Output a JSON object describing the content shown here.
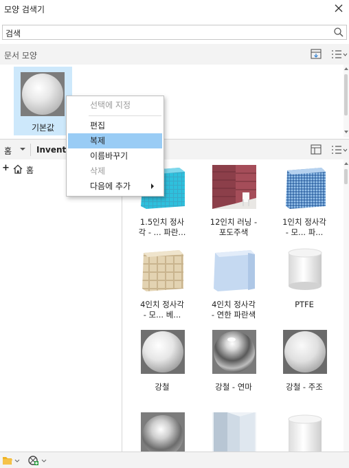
{
  "window": {
    "title": "모양 검색기",
    "close_icon": "close-icon"
  },
  "search": {
    "value": "검색",
    "icon": "search-icon"
  },
  "document_section": {
    "label": "문서 모양",
    "items": [
      {
        "name": "기본값",
        "icon": "sphere-material"
      }
    ]
  },
  "library_bar": {
    "home_label": "홈",
    "library_name": "Inventor"
  },
  "tree": {
    "expand": "+",
    "root_label": "홈"
  },
  "context_menu": {
    "items": [
      {
        "label": "선택에 지정",
        "disabled": true
      },
      {
        "label": "편집",
        "disabled": false
      },
      {
        "label": "복제",
        "disabled": false,
        "highlighted": true
      },
      {
        "label": "이름바꾸기",
        "disabled": false
      },
      {
        "label": "삭제",
        "disabled": true
      },
      {
        "label": "다음에 추가",
        "disabled": false,
        "submenu": true
      }
    ]
  },
  "materials": [
    {
      "label": "1.5인치 정사\n각 - ... 파란...",
      "swatch": "blue-tile"
    },
    {
      "label": "12인치 러닝 -\n포도주색",
      "swatch": "burgundy-brick"
    },
    {
      "label": "1인치 정사각\n- 모... 파...",
      "swatch": "blue-mosaic"
    },
    {
      "label": "4인치 정사각\n- 모... 베...",
      "swatch": "beige-tile"
    },
    {
      "label": "4인치 정사각\n- 연한 파란색",
      "swatch": "light-blue-cube"
    },
    {
      "label": "PTFE",
      "swatch": "white-cylinder"
    },
    {
      "label": "강철",
      "swatch": "matte-sphere"
    },
    {
      "label": "강철 - 연마",
      "swatch": "chrome-sphere"
    },
    {
      "label": "강철 - 주조",
      "swatch": "cast-sphere"
    },
    {
      "label": "",
      "swatch": "chrome-sphere-2"
    },
    {
      "label": "",
      "swatch": "bent-sheet"
    },
    {
      "label": "",
      "swatch": "white-cylinder-2"
    }
  ],
  "colors": {
    "highlight": "#99ccf5",
    "selection": "#cde8fb",
    "folder": "#f0b323",
    "add_green": "#2ea043"
  }
}
